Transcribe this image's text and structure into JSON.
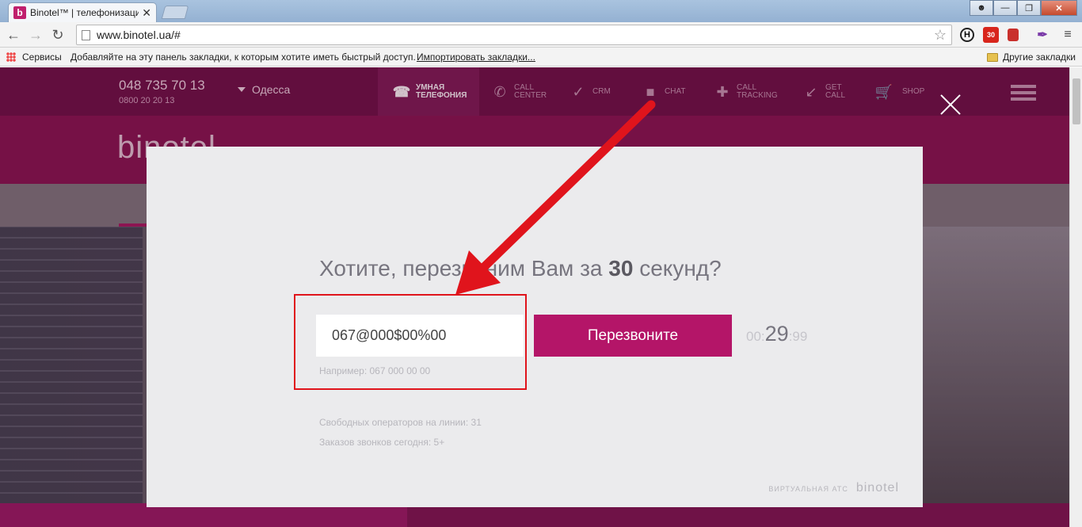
{
  "browser": {
    "tab_title": "Binotel™ | телефонизаци",
    "tab_close": "✕",
    "favicon_letter": "b",
    "url": "www.binotel.ua/#",
    "bookmarks": {
      "apps_label": "Сервисы",
      "hint": "Добавляйте на эту панель закладки, к которым хотите иметь быстрый доступ.",
      "import_link": "Импортировать закладки...",
      "other": "Другие закладки"
    },
    "ext_badge": "30"
  },
  "site": {
    "phone_main": "048 735 70 13",
    "phone_sub": "0800 20 20 13",
    "city": "Одесса",
    "nav": [
      {
        "label1": "УМНАЯ",
        "label2": "ТЕЛЕФОНИЯ",
        "icon": "phone-book-icon"
      },
      {
        "label1": "CALL",
        "label2": "CENTER",
        "icon": "handset-icon"
      },
      {
        "label1": "CRM",
        "label2": "",
        "icon": "check-icon"
      },
      {
        "label1": "CHAT",
        "label2": "",
        "icon": "chat-icon"
      },
      {
        "label1": "CALL",
        "label2": "TRACKING",
        "icon": "crosshair-icon"
      },
      {
        "label1": "GET",
        "label2": "CALL",
        "icon": "phone-arrow-icon"
      },
      {
        "label1": "SHOP",
        "label2": "",
        "icon": "cart-icon"
      }
    ],
    "logo": "binotel"
  },
  "modal": {
    "headline_pre": "Хотите, перезвоним Вам за ",
    "headline_bold": "30",
    "headline_post": " секунд?",
    "phone_value": "067@000$00%00",
    "button_label": "Перезвоните",
    "timer_min": "00:",
    "timer_sec": "29",
    "timer_ms": ":99",
    "example": "Например: 067 000 00 00",
    "stat_operators": "Свободных операторов на линии: 31",
    "stat_orders": "Заказов звонков сегодня: 5+",
    "footer_label": "ВИРТУАЛЬНАЯ АТС",
    "footer_logo": "binotel"
  },
  "colors": {
    "brand": "#b41568",
    "annotation_red": "#e0141c"
  }
}
